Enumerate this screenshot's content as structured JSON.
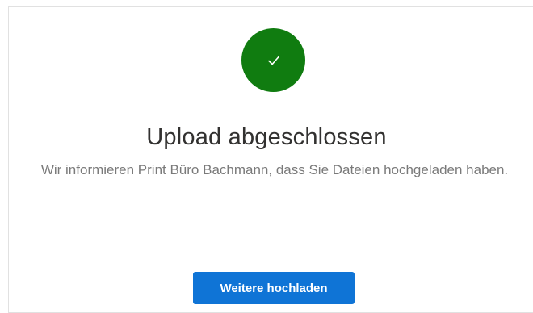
{
  "status": {
    "icon": "checkmark-icon",
    "color": "#107c10"
  },
  "title": "Upload abgeschlossen",
  "message": "Wir informieren Print Büro Bachmann, dass Sie Dateien hochgeladen haben.",
  "actions": {
    "upload_more_label": "Weitere hochladen",
    "upload_more_color": "#0f74d6"
  }
}
